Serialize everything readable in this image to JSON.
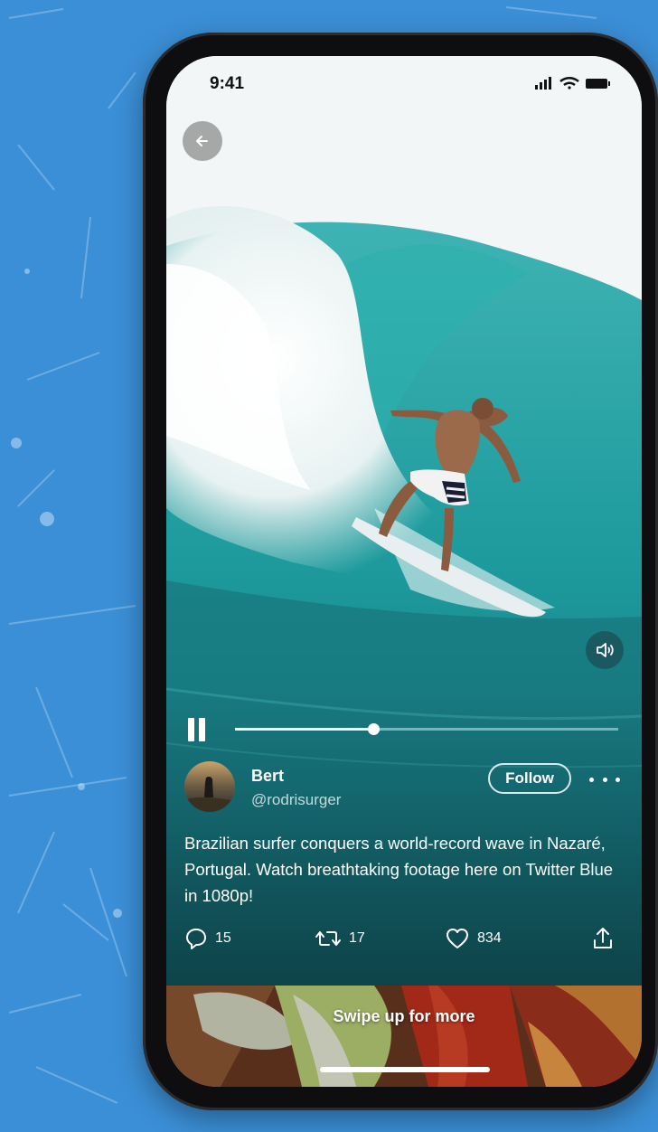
{
  "status_bar": {
    "time": "9:41"
  },
  "video": {
    "progress": 0.36
  },
  "tweet": {
    "author_name": "Bert",
    "author_handle": "@rodrisurger",
    "follow_label": "Follow",
    "text": "Brazilian surfer conquers a world-record wave in Nazaré, Portugal. Watch breathtaking footage here on Twitter Blue in 1080p!",
    "replies": "15",
    "retweets": "17",
    "likes": "834"
  },
  "next": {
    "swipe_label": "Swipe up for more"
  },
  "icons": {
    "back": "arrow-left-icon",
    "sound": "speaker-icon",
    "pause": "pause-icon",
    "more": "more-horizontal-icon",
    "reply": "comment-icon",
    "retweet": "retweet-icon",
    "like": "heart-icon",
    "share": "share-icon"
  },
  "colors": {
    "background": "#3b8fd6",
    "wave": "#1f9e9e",
    "phone_frame": "#0e0e10"
  }
}
